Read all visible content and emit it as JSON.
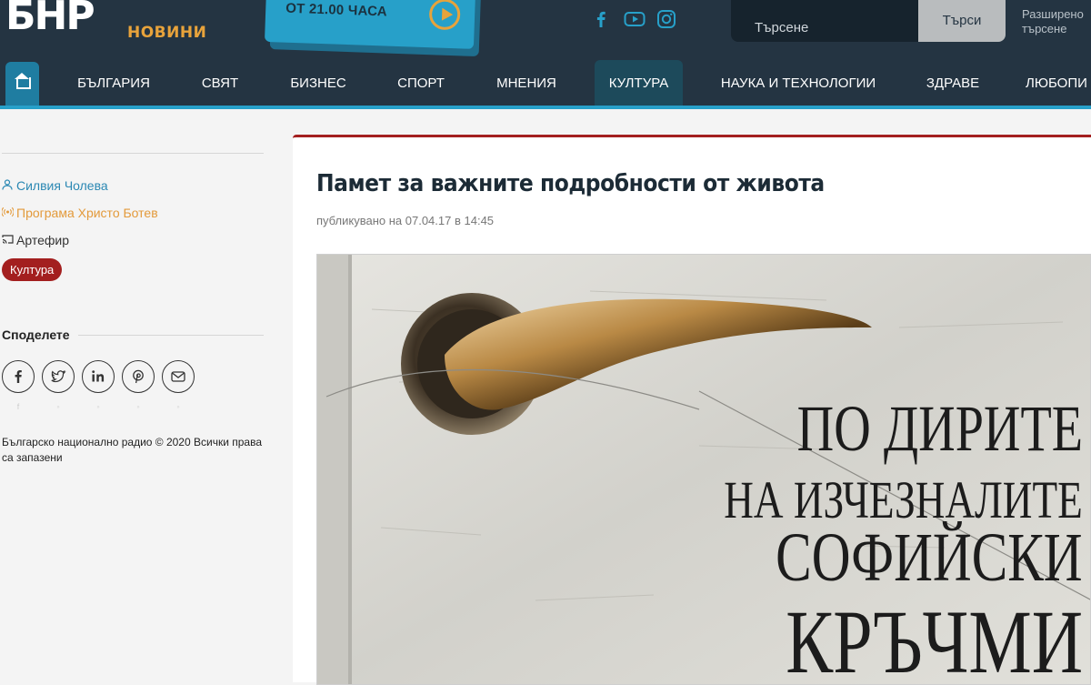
{
  "header": {
    "logo": {
      "mark": "БНР",
      "sub": "НОВИНИ"
    },
    "promo": {
      "text": "ОТ 21.00 ЧАСА"
    },
    "social": [
      "facebook-icon",
      "youtube-icon",
      "instagram-icon"
    ],
    "search": {
      "placeholder": "Търсене",
      "button": "Търси",
      "advanced": "Разширено търсене"
    }
  },
  "nav": {
    "items": [
      {
        "label": "БЪЛГАРИЯ"
      },
      {
        "label": "СВЯТ"
      },
      {
        "label": "БИЗНЕС"
      },
      {
        "label": "СПОРТ"
      },
      {
        "label": "МНЕНИЯ"
      },
      {
        "label": "КУЛТУРА",
        "active": true
      },
      {
        "label": "НАУКА И ТЕХНОЛОГИИ"
      },
      {
        "label": "ЗДРАВЕ"
      },
      {
        "label": "ЛЮБОПИ"
      }
    ]
  },
  "sidebar": {
    "author": "Силвия Чолева",
    "program": "Програма Христо Ботев",
    "show": "Артефир",
    "tag": "Култура",
    "share_title": "Споделете",
    "share_buttons": [
      "facebook-icon",
      "twitter-icon",
      "linkedin-icon",
      "pinterest-icon",
      "email-icon"
    ],
    "copyright": "Българско национално радио © 2020 Всички права са запазени"
  },
  "article": {
    "title": "Памет за важните подробности от живота",
    "meta": "публикувано на 07.04.17 в 14:45",
    "image_text": [
      "ПО ДИРИТЕ",
      "НА ИЗЧЕЗНАЛИТЕ",
      "СОФИЙСКИ",
      "КРЪЧМИ"
    ]
  },
  "colors": {
    "header_bg": "#243442",
    "accent_blue": "#27a0c9",
    "accent_orange": "#e8a33b",
    "accent_red": "#a31f1f"
  }
}
